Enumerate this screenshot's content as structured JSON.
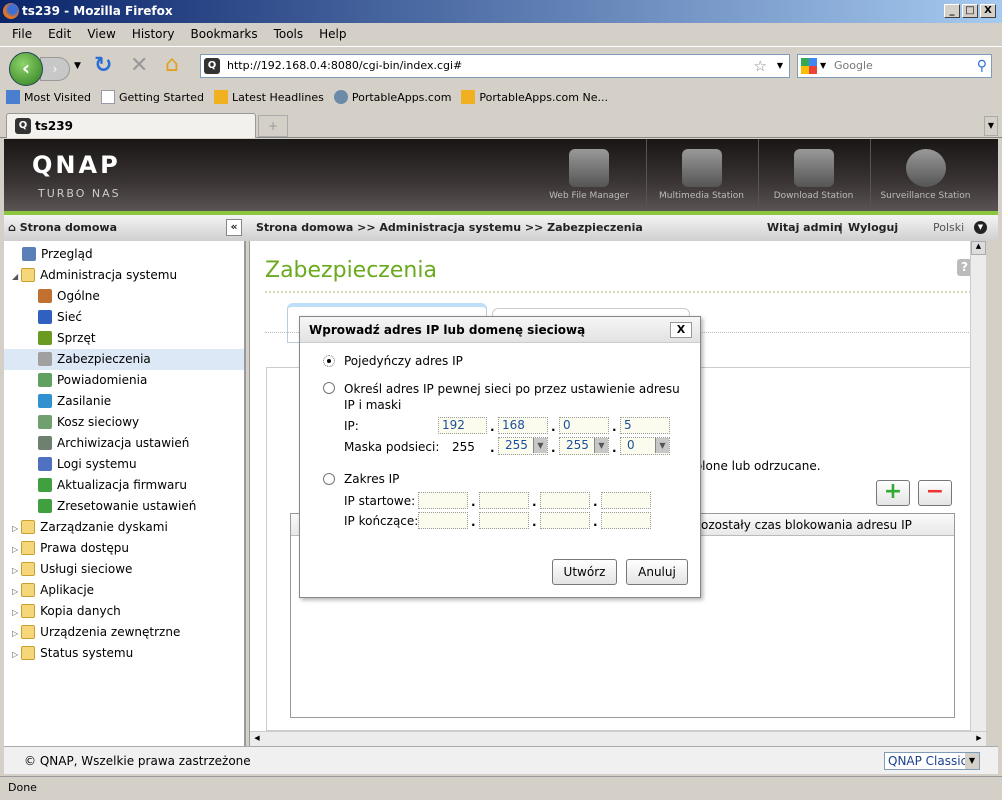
{
  "window": {
    "title": "ts239 - Mozilla Firefox"
  },
  "menu": [
    "File",
    "Edit",
    "View",
    "History",
    "Bookmarks",
    "Tools",
    "Help"
  ],
  "nav": {
    "url": "http://192.168.0.4:8080/cgi-bin/index.cgi#",
    "search_placeholder": "Google"
  },
  "bookmarks": [
    "Most Visited",
    "Getting Started",
    "Latest Headlines",
    "PortableApps.com",
    "PortableApps.com Ne..."
  ],
  "tab": {
    "label": "ts239",
    "new_tab": "+"
  },
  "header": {
    "logo": "QNAP",
    "sub": "TURBO NAS",
    "apps": [
      "Web File Manager",
      "Multimedia Station",
      "Download Station",
      "Surveillance Station"
    ]
  },
  "crumbbar": {
    "home": "Strona domowa",
    "breadcrumb": "Strona domowa >> Administracja systemu >> Zabezpieczenia",
    "welcome": "Witaj admin",
    "logout": "Wyloguj",
    "sep": "|",
    "language": "Polski",
    "collapse": "«"
  },
  "sidebar": {
    "items": [
      {
        "label": "Przegląd",
        "level": 0
      },
      {
        "label": "Administracja systemu",
        "level": 0,
        "expanded": true
      },
      {
        "label": "Ogólne",
        "level": 1
      },
      {
        "label": "Sieć",
        "level": 1
      },
      {
        "label": "Sprzęt",
        "level": 1
      },
      {
        "label": "Zabezpieczenia",
        "level": 1,
        "selected": true
      },
      {
        "label": "Powiadomienia",
        "level": 1
      },
      {
        "label": "Zasilanie",
        "level": 1
      },
      {
        "label": "Kosz sieciowy",
        "level": 1
      },
      {
        "label": "Archiwizacja ustawień",
        "level": 1
      },
      {
        "label": "Logi systemu",
        "level": 1
      },
      {
        "label": "Aktualizacja firmwaru",
        "level": 1
      },
      {
        "label": "Zresetowanie ustawień",
        "level": 1
      },
      {
        "label": "Zarządzanie dyskami",
        "level": 0
      },
      {
        "label": "Prawa dostępu",
        "level": 0
      },
      {
        "label": "Usługi sieciowe",
        "level": 0
      },
      {
        "label": "Aplikacje",
        "level": 0
      },
      {
        "label": "Kopia danych",
        "level": 0
      },
      {
        "label": "Urządzenia zewnętrzne",
        "level": 0
      },
      {
        "label": "Status systemu",
        "level": 0
      }
    ]
  },
  "main": {
    "title": "Zabezpieczenia",
    "help": "?",
    "partial_text": "wolone lub odrzucane.",
    "partial_column": "ozostały czas blokowania adresu IP",
    "add": "+",
    "remove": "−"
  },
  "dialog": {
    "title": "Wprowadź adres IP lub domenę sieciową",
    "close": "X",
    "option_single": "Pojedyńczy adres IP",
    "option_network": "Określ adres IP pewnej sieci po przez ustawienie adresu IP i maski",
    "ip_label": "IP:",
    "ip": [
      "192",
      "168",
      "0",
      "5"
    ],
    "mask_label": "Maska podsieci:",
    "mask": [
      "255",
      "255",
      "255",
      "0"
    ],
    "option_range": "Zakres IP",
    "start_label": "IP startowe:",
    "end_label": "IP kończące:",
    "selected_option": "single",
    "create": "Utwórz",
    "cancel": "Anuluj"
  },
  "footer": {
    "copyright": "© QNAP, Wszelkie prawa zastrzeżone",
    "theme": "QNAP Classic"
  },
  "status": "Done",
  "colors": {
    "accent_green": "#6aaa1e",
    "header_dark": "#2a2424",
    "selection": "#dce8f6"
  }
}
